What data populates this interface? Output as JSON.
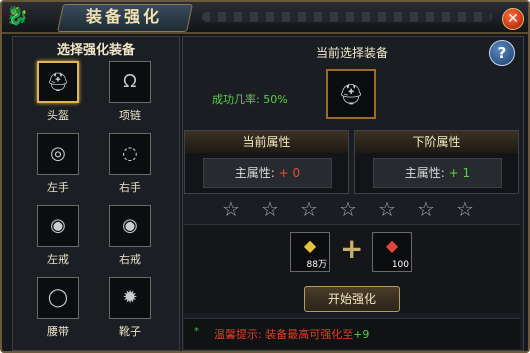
{
  "window": {
    "title": "装备强化"
  },
  "left_panel": {
    "title": "选择强化装备",
    "slots": [
      {
        "label": "头盔",
        "icon": "helmet-icon",
        "glyph": "⛑",
        "selected": true
      },
      {
        "label": "项链",
        "icon": "necklace-icon",
        "glyph": "ᘯ",
        "selected": false
      },
      {
        "label": "左手",
        "icon": "bracelet-icon",
        "glyph": "◎",
        "selected": false
      },
      {
        "label": "右手",
        "icon": "beads-icon",
        "glyph": "◌",
        "selected": false
      },
      {
        "label": "左戒",
        "icon": "ring-icon",
        "glyph": "◉",
        "selected": false
      },
      {
        "label": "右戒",
        "icon": "ring-icon",
        "glyph": "◉",
        "selected": false
      },
      {
        "label": "腰带",
        "icon": "belt-icon",
        "glyph": "◯",
        "selected": false
      },
      {
        "label": "靴子",
        "icon": "boots-icon",
        "glyph": "✹",
        "selected": false
      }
    ]
  },
  "right_panel": {
    "current_label": "当前选择装备",
    "success_text": "成功几率: 50%",
    "current_attr": {
      "title": "当前属性",
      "stat_label": "主属性:",
      "stat_value": "+ 0"
    },
    "next_attr": {
      "title": "下阶属性",
      "stat_label": "主属性:",
      "stat_value": "+ 1"
    },
    "star_count": 7,
    "stars_filled": 0,
    "materials": [
      {
        "icon": "gold-ingot-icon",
        "glyph": "◆",
        "count": "88万",
        "color": "#e7c440"
      },
      {
        "icon": "red-gem-icon",
        "glyph": "◆",
        "count": "100",
        "color": "#e0443a"
      }
    ],
    "plus_symbol": "+",
    "start_button": "开始强化",
    "tip": {
      "bullet": "*",
      "text": "温馨提示: 装备最高可强化至",
      "value": "+9"
    }
  },
  "colors": {
    "success": "#55d043",
    "warning": "#e63b25",
    "accent": "#e2b554"
  }
}
